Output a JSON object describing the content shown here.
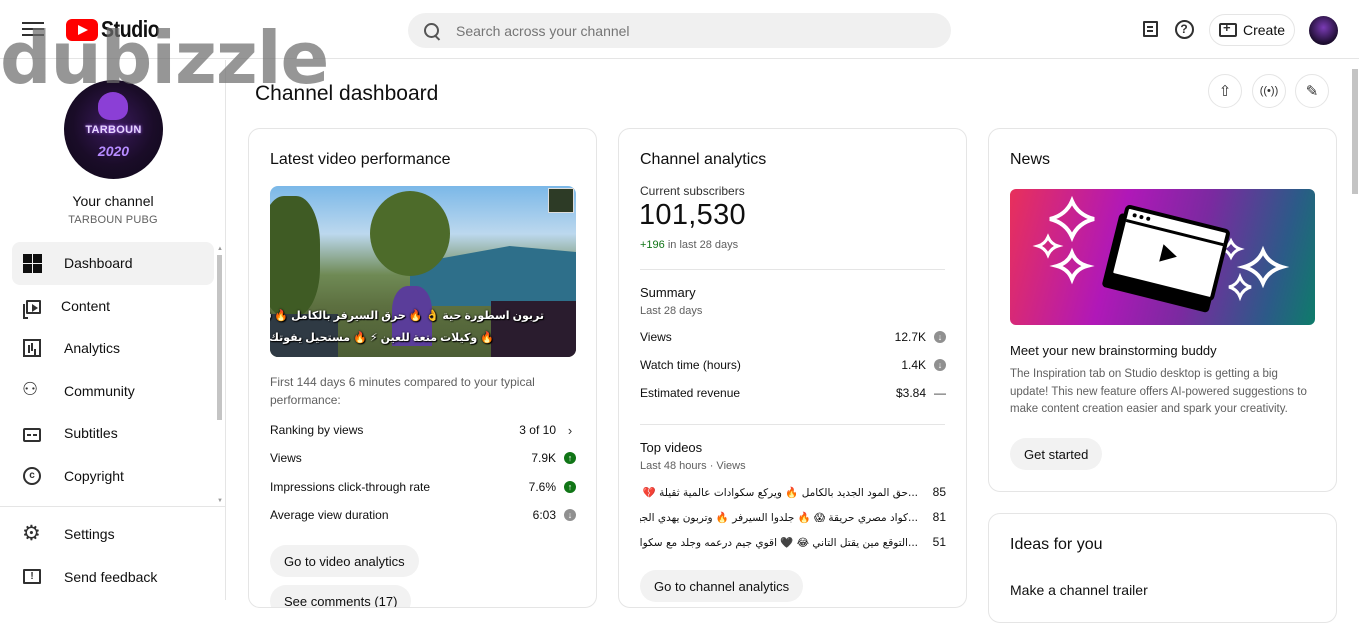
{
  "app": {
    "logo_text": "Studio",
    "watermark": "dubizzle"
  },
  "topbar": {
    "search_placeholder": "Search across your channel",
    "create_label": "Create"
  },
  "sidebar": {
    "channel_label": "Your channel",
    "channel_handle": "TARBOUN PUBG",
    "avatar_name": "TARBOUN",
    "avatar_year": "2020",
    "items": [
      {
        "label": "Dashboard",
        "icon": "dashboard-icon",
        "active": true
      },
      {
        "label": "Content",
        "icon": "content-icon"
      },
      {
        "label": "Analytics",
        "icon": "analytics-icon"
      },
      {
        "label": "Community",
        "icon": "community-icon"
      },
      {
        "label": "Subtitles",
        "icon": "subtitles-icon"
      },
      {
        "label": "Copyright",
        "icon": "copyright-icon"
      }
    ],
    "bottom_items": [
      {
        "label": "Settings",
        "icon": "settings-icon"
      },
      {
        "label": "Send feedback",
        "icon": "feedback-icon"
      }
    ]
  },
  "main": {
    "page_title": "Channel dashboard",
    "latest_video": {
      "title": "Latest video performance",
      "thumbnail_caption_line1": "تربون اسطورة حية 👌 🔥 حرق السيرفر بالكامل 🔥 😱",
      "thumbnail_caption_line2": "🔥 وكيلات متعة للعين ⚡ 🔥 مستحيل يفوتك",
      "description": "First 144 days 6 minutes compared to your typical performance:",
      "metrics": [
        {
          "label": "Ranking by views",
          "value": "3 of 10",
          "indicator": "chevron"
        },
        {
          "label": "Views",
          "value": "7.9K",
          "indicator": "up"
        },
        {
          "label": "Impressions click-through rate",
          "value": "7.6%",
          "indicator": "up"
        },
        {
          "label": "Average view duration",
          "value": "6:03",
          "indicator": "down"
        }
      ],
      "button_analytics": "Go to video analytics",
      "button_comments": "See comments (17)"
    },
    "channel_analytics": {
      "title": "Channel analytics",
      "subscribers_label": "Current subscribers",
      "subscribers_count": "101,530",
      "subscribers_change": "+196",
      "subscribers_change_suffix": " in last 28 days",
      "summary_title": "Summary",
      "summary_period": "Last 28 days",
      "summary": [
        {
          "label": "Views",
          "value": "12.7K",
          "indicator": "down"
        },
        {
          "label": "Watch time (hours)",
          "value": "1.4K",
          "indicator": "down"
        },
        {
          "label": "Estimated revenue",
          "value": "$3.84",
          "indicator": "dash"
        }
      ],
      "top_videos_title": "Top videos",
      "top_videos_period": "Last 48 hours · Views",
      "top_videos": [
        {
          "title": "...حق المود الجديد بالكامل 🔥 ويركع سكوادات عالمية ثقيلة 💔 ونهاية حزينة",
          "views": "85"
        },
        {
          "title": "...كواد مصري حريقة 😱 🔥 جلدوا السيرفر 🔥 وتربون يهدي الجيم لتركي",
          "views": "81"
        },
        {
          "title": "...التوقع مين يقتل التاني 😂 🖤 اقوي جيم درعمه وجلد مع سكواد مصري سالك",
          "views": "51"
        }
      ],
      "button": "Go to channel analytics"
    },
    "news": {
      "title": "News",
      "headline": "Meet your new brainstorming buddy",
      "body": "The Inspiration tab on Studio desktop is getting a big update! This new feature offers AI-powered suggestions to make content creation easier and spark your creativity.",
      "button": "Get started"
    },
    "ideas": {
      "title": "Ideas for you",
      "first_item": "Make a channel trailer"
    }
  },
  "colors": {
    "brand_red": "#ff0000",
    "up_green": "#107516",
    "down_gray": "#909090"
  }
}
